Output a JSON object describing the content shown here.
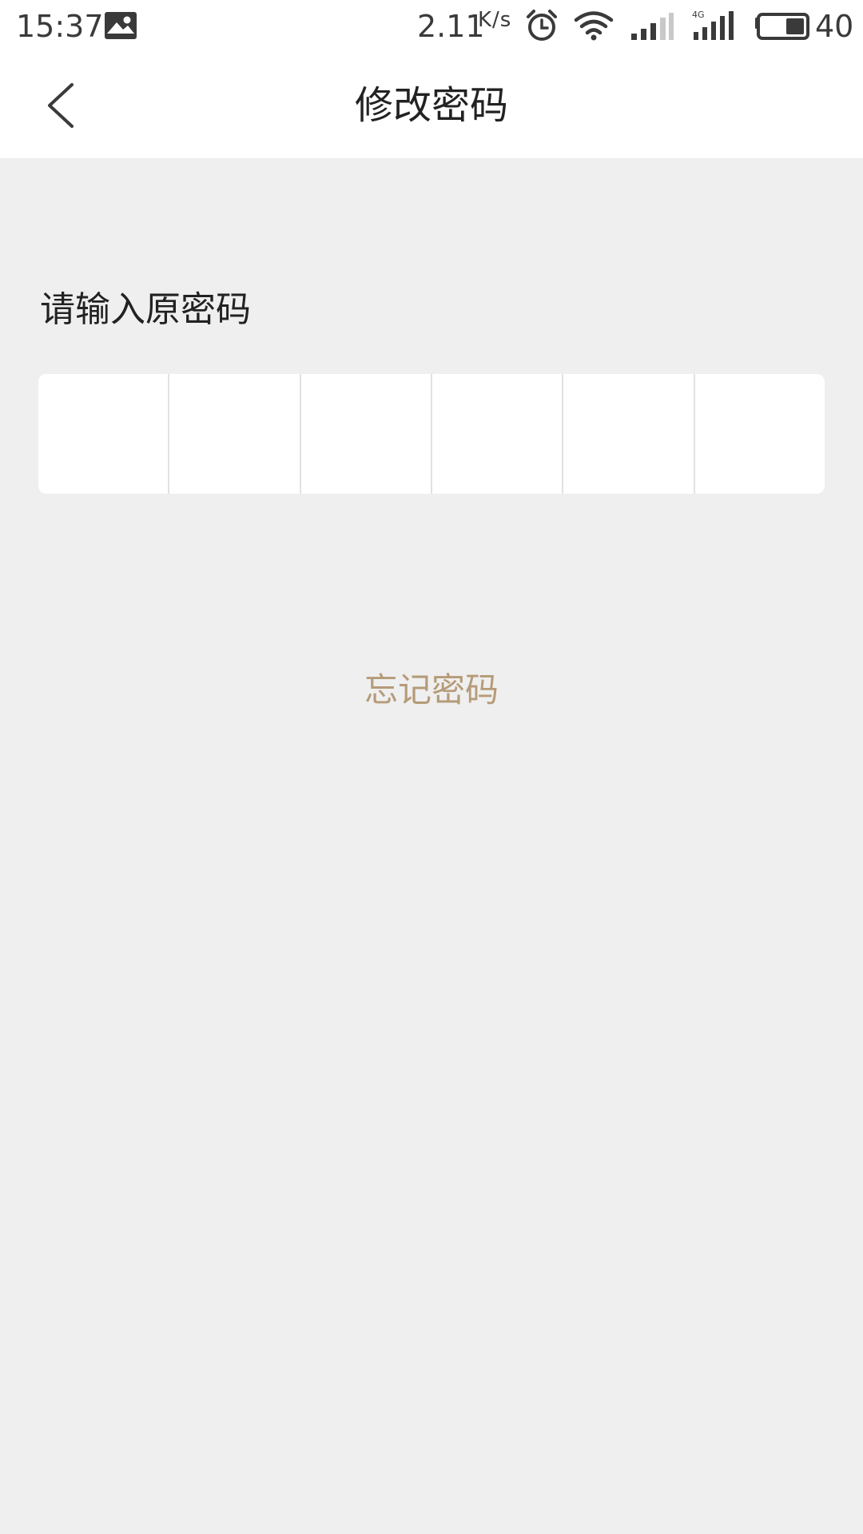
{
  "status_bar": {
    "time": "15:37",
    "net_speed": "2.11",
    "net_speed_unit": "K/s",
    "network_type": "4G",
    "battery": "40",
    "icons": [
      "image-notification-icon",
      "alarm-icon",
      "wifi-icon",
      "signal-icon",
      "signal-4g-icon",
      "battery-icon"
    ]
  },
  "navbar": {
    "title": "修改密码",
    "back_icon": "chevron-left-icon"
  },
  "form": {
    "prompt": "请输入原密码",
    "pin_cells": [
      "",
      "",
      "",
      "",
      "",
      ""
    ]
  },
  "forgot_password": "忘记密码",
  "colors": {
    "background": "#efefef",
    "surface": "#ffffff",
    "text": "#222222",
    "accent": "#b59b78",
    "divider": "#e2e2e2"
  }
}
